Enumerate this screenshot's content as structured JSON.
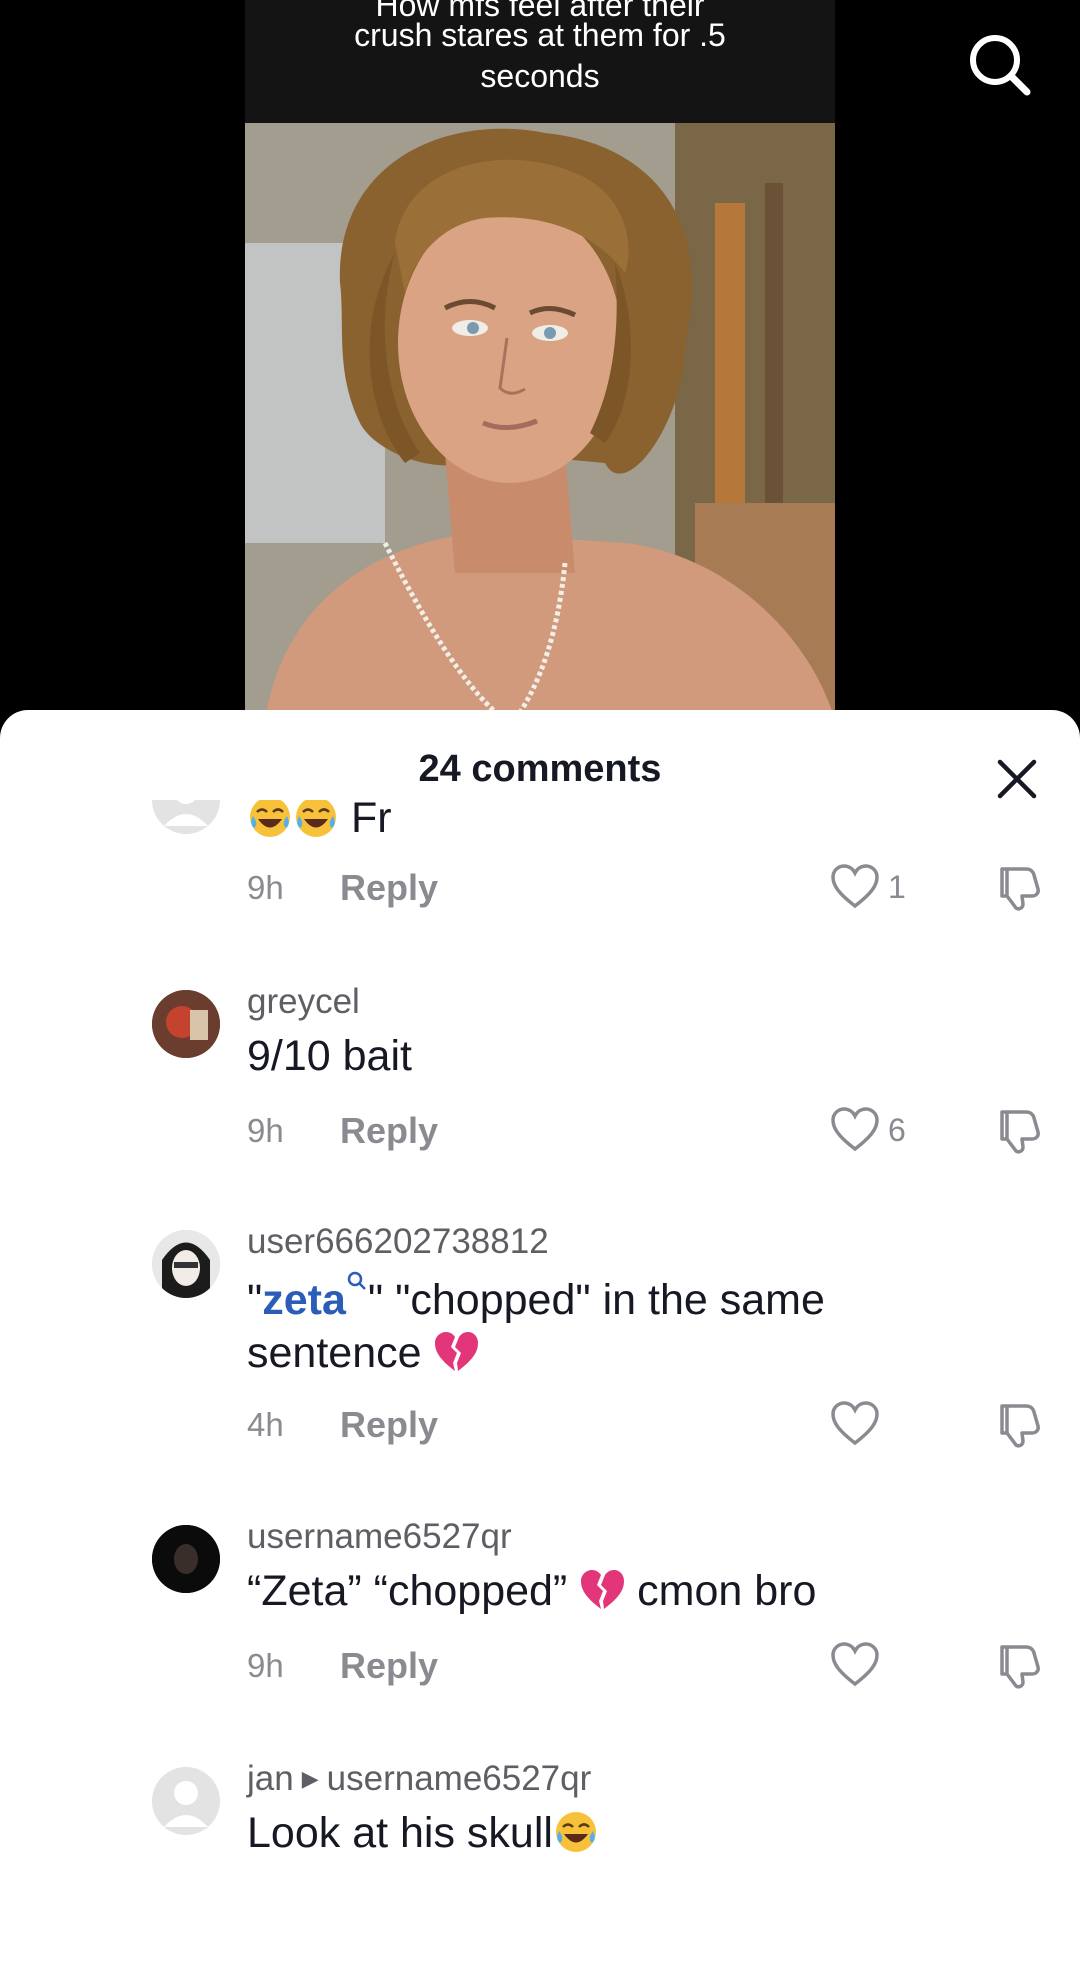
{
  "video": {
    "caption_partial": "How mfs feel after their",
    "caption_line2": "crush stares at them for .5",
    "caption_line3": "seconds"
  },
  "icons": {
    "search": "search-icon",
    "close": "close-icon",
    "like": "heart-icon",
    "dislike": "dislike-icon"
  },
  "sheet": {
    "title": "24 comments"
  },
  "comments": [
    {
      "username_partial": "",
      "text": "Fr",
      "emojis": [
        "laughing-crying",
        "laughing-crying"
      ],
      "time": "9h",
      "reply_label": "Reply",
      "likes": "1"
    },
    {
      "username": "greycel",
      "text": "9/10 bait",
      "time": "9h",
      "reply_label": "Reply",
      "likes": "6"
    },
    {
      "username": "user666202738812",
      "text_open_quote": "\"",
      "link_text": "zeta",
      "text_rest": "\" \"chopped\" in the same",
      "text_line2": "sentence ",
      "time": "4h",
      "reply_label": "Reply",
      "likes": ""
    },
    {
      "username": "username6527qr",
      "text_a": "“Zeta” “chopped” ",
      "text_b": " cmon bro",
      "time": "9h",
      "reply_label": "Reply",
      "likes": ""
    },
    {
      "username": "jan",
      "reply_to": "username6527qr",
      "text": "Look at his skull"
    }
  ],
  "colors": {
    "link": "#2b5db8",
    "text": "#161823",
    "muted": "#8a8b91",
    "heartbreak": "#e2357a"
  }
}
